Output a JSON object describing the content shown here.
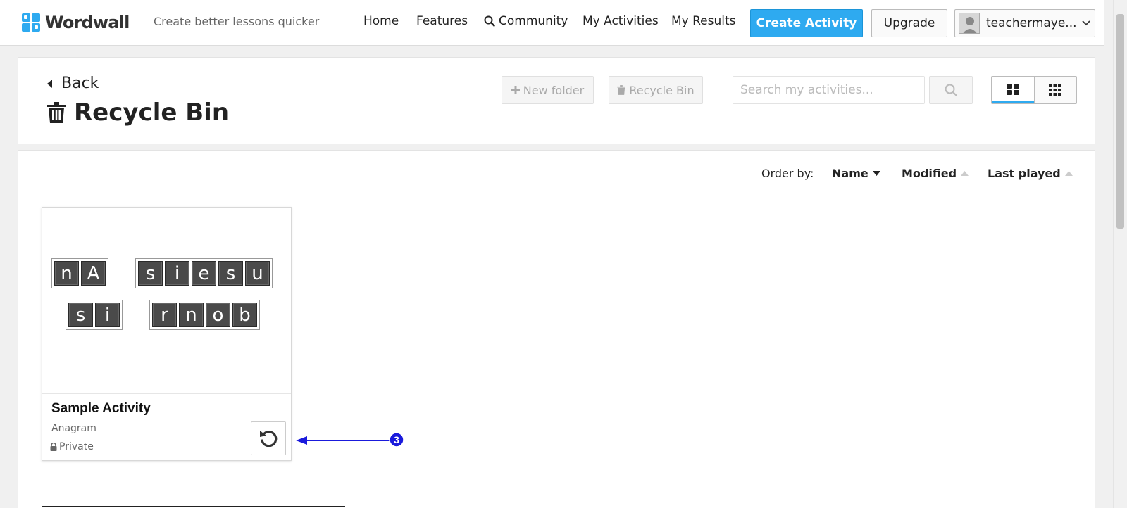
{
  "header": {
    "logo_text": "Wordwall",
    "tagline": "Create better lessons quicker",
    "nav": {
      "home": "Home",
      "features": "Features",
      "community": "Community",
      "my_activities": "My Activities",
      "my_results": "My Results"
    },
    "create_activity": "Create Activity",
    "upgrade": "Upgrade",
    "user_name": "teachermaye...",
    "accent_color": "#2eaaf0"
  },
  "toolbar": {
    "back": "Back",
    "title": "Recycle Bin",
    "new_folder": "New folder",
    "recycle_bin": "Recycle Bin",
    "search_placeholder": "Search my activities..."
  },
  "sort": {
    "label": "Order by:",
    "options": [
      "Name",
      "Modified",
      "Last played"
    ],
    "active": "Name"
  },
  "activity": {
    "title": "Sample Activity",
    "type": "Anagram",
    "privacy": "Private",
    "thumbnail_rows": [
      [
        [
          "n",
          "A"
        ],
        [
          "s",
          "i",
          "e",
          "s",
          "u"
        ]
      ],
      [
        [
          "s",
          "i"
        ],
        [
          "r",
          "n",
          "o",
          "b"
        ]
      ]
    ]
  },
  "annotation": {
    "step": "3",
    "color": "#1a1adc"
  }
}
